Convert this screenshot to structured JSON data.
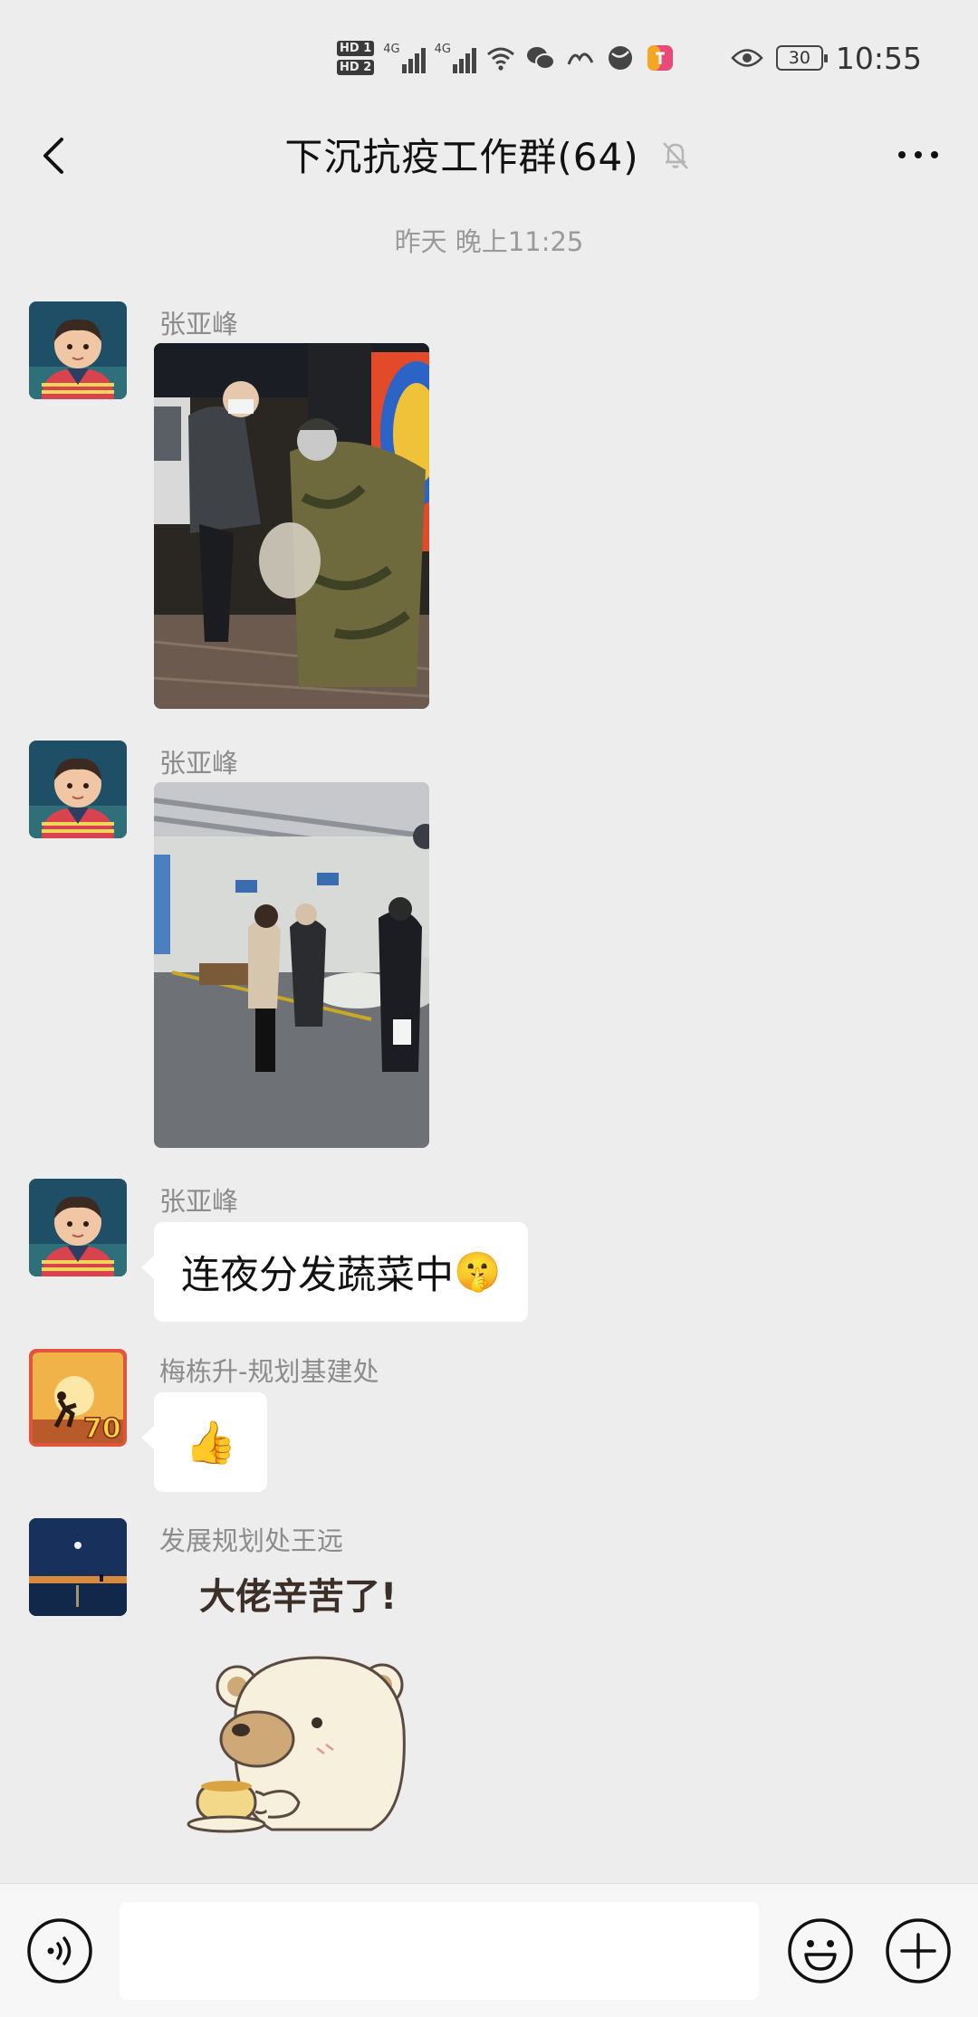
{
  "status_bar": {
    "hd1": "HD 1",
    "hd2": "HD 2",
    "net1": "4G",
    "net2": "4G",
    "battery": "30",
    "time": "10:55"
  },
  "nav": {
    "title": "下沉抗疫工作群(64)"
  },
  "chat": {
    "timestamp": "昨天 晚上11:25",
    "messages": [
      {
        "sender": "张亚峰",
        "type": "image"
      },
      {
        "sender": "张亚峰",
        "type": "image"
      },
      {
        "sender": "张亚峰",
        "type": "text",
        "text": "连夜分发蔬菜中",
        "emoji": "🤫"
      },
      {
        "sender": "梅栋升-规划基建处",
        "type": "text",
        "emoji": "👍"
      },
      {
        "sender": "发展规划处王远",
        "type": "sticker",
        "sticker_text": "大佬辛苦了!"
      }
    ]
  },
  "input": {
    "placeholder": ""
  },
  "colors": {
    "background": "#ededed",
    "bubble": "#ffffff",
    "input_bar": "#f7f7f7"
  }
}
